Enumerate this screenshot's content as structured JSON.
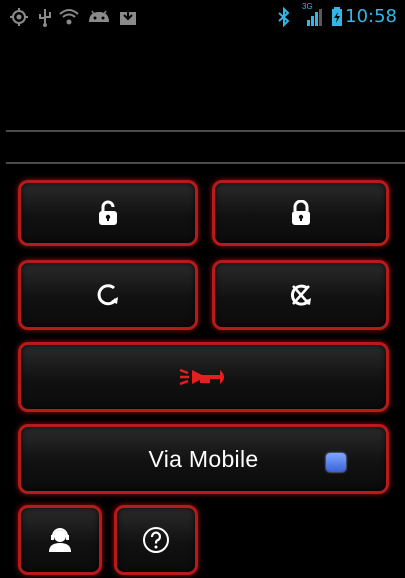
{
  "status_bar": {
    "time": "10:58",
    "network": "3G",
    "left_icons": [
      "gps-icon",
      "usb-icon",
      "wifi-icon",
      "android-debug-icon",
      "download-icon"
    ],
    "right_icons": [
      "bluetooth-icon",
      "signal-icon",
      "battery-icon"
    ],
    "accent_color": "#33b5e5"
  },
  "controls": {
    "buttons": [
      {
        "name": "unlock-button",
        "icon": "unlock-icon"
      },
      {
        "name": "lock-button",
        "icon": "lock-icon"
      },
      {
        "name": "start-engine-button",
        "icon": "rotate-icon"
      },
      {
        "name": "stop-engine-button",
        "icon": "rotate-cancel-icon"
      },
      {
        "name": "horn-button",
        "icon": "horn-icon"
      }
    ],
    "mobile_toggle": {
      "label": "Via Mobile",
      "checked": true
    },
    "bottom_buttons": [
      {
        "name": "support-button",
        "icon": "support-agent-icon"
      },
      {
        "name": "help-button",
        "icon": "help-icon"
      }
    ]
  },
  "theme": {
    "border_color": "#b71a1a",
    "horn_color": "#e41f1f",
    "icon_color": "#ffffff"
  }
}
